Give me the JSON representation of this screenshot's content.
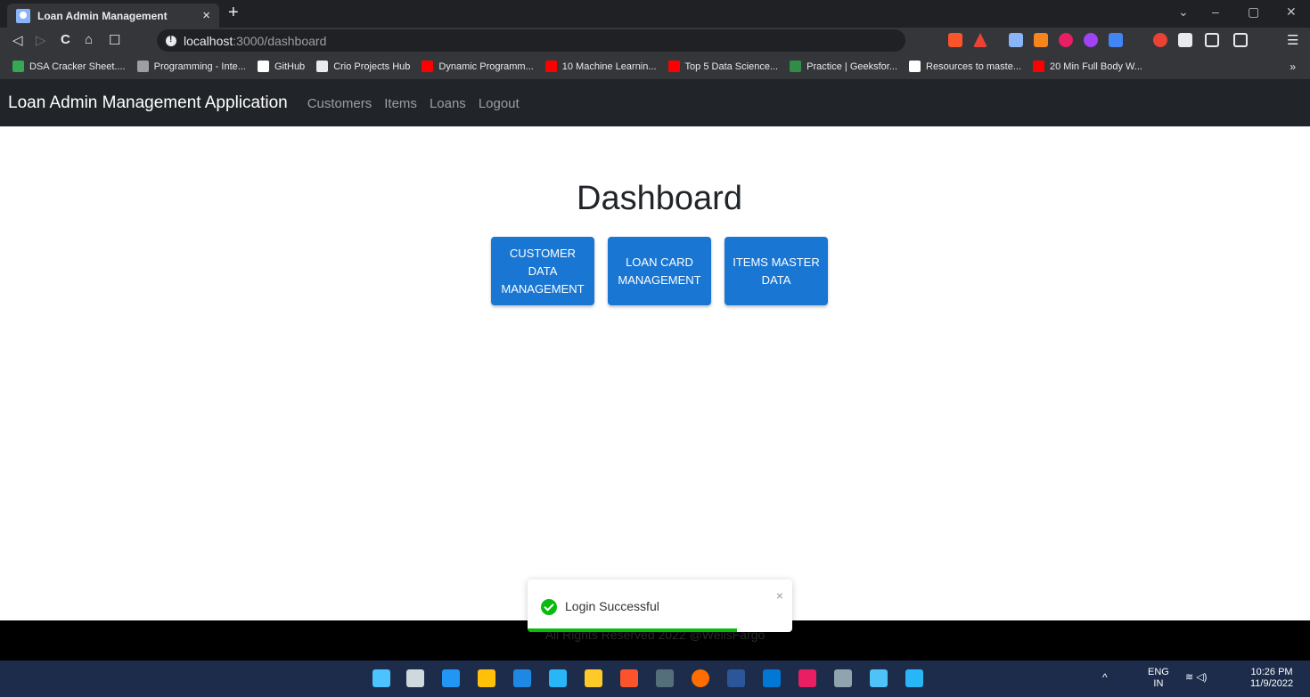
{
  "browser": {
    "tab_title": "Loan Admin Management",
    "tab_close": "×",
    "new_tab": "+",
    "url_host": "localhost",
    "url_path": ":3000/dashboard",
    "window_controls": {
      "minimize": "–",
      "maximize": "▢",
      "close": "✕",
      "tab_search": "⌄"
    },
    "nav": {
      "back": "◁",
      "forward": "▷",
      "reload": "C",
      "home": "⌂",
      "bookmark": "☐"
    },
    "bookmarks_more": "»",
    "bookmarks": [
      {
        "label": "DSA Cracker Sheet....",
        "icon": "google-drive-icon",
        "color": "#34a853"
      },
      {
        "label": "Programming - Inte...",
        "icon": "mountain-icon",
        "color": "#9aa0a6"
      },
      {
        "label": "GitHub",
        "icon": "github-icon",
        "color": "#ffffff"
      },
      {
        "label": "Crio Projects Hub",
        "icon": "crio-icon",
        "color": "#e8eaed"
      },
      {
        "label": "Dynamic Programm...",
        "icon": "youtube-icon",
        "color": "#ff0000"
      },
      {
        "label": "10 Machine Learnin...",
        "icon": "youtube-icon",
        "color": "#ff0000"
      },
      {
        "label": "Top 5 Data Science...",
        "icon": "youtube-icon",
        "color": "#ff0000"
      },
      {
        "label": "Practice | Geeksfor...",
        "icon": "geeksforgeeks-icon",
        "color": "#2f8d46"
      },
      {
        "label": "Resources to maste...",
        "icon": "medium-icon",
        "color": "#ffffff"
      },
      {
        "label": "20 Min Full Body W...",
        "icon": "youtube-icon",
        "color": "#ff0000"
      }
    ]
  },
  "app": {
    "brand": "Loan Admin Management Application",
    "nav_links": [
      "Customers",
      "Items",
      "Loans",
      "Logout"
    ],
    "heading": "Dashboard",
    "cards": [
      {
        "label": "CUSTOMER DATA MANAGEMENT"
      },
      {
        "label": "LOAN CARD MANAGEMENT"
      },
      {
        "label": "ITEMS MASTER DATA"
      }
    ],
    "footer": "All Rights Reserved 2022 @WellsFargo",
    "accent_color": "#1976d2"
  },
  "toast": {
    "message": "Login Successful",
    "close": "×",
    "progress": 0.79,
    "color": "#07bc0c"
  },
  "taskbar": {
    "lang_top": "ENG",
    "lang_bottom": "IN",
    "time": "10:26 PM",
    "date": "11/9/2022",
    "tray_chevron": "^",
    "tray_icons": "≋ ◁)"
  }
}
